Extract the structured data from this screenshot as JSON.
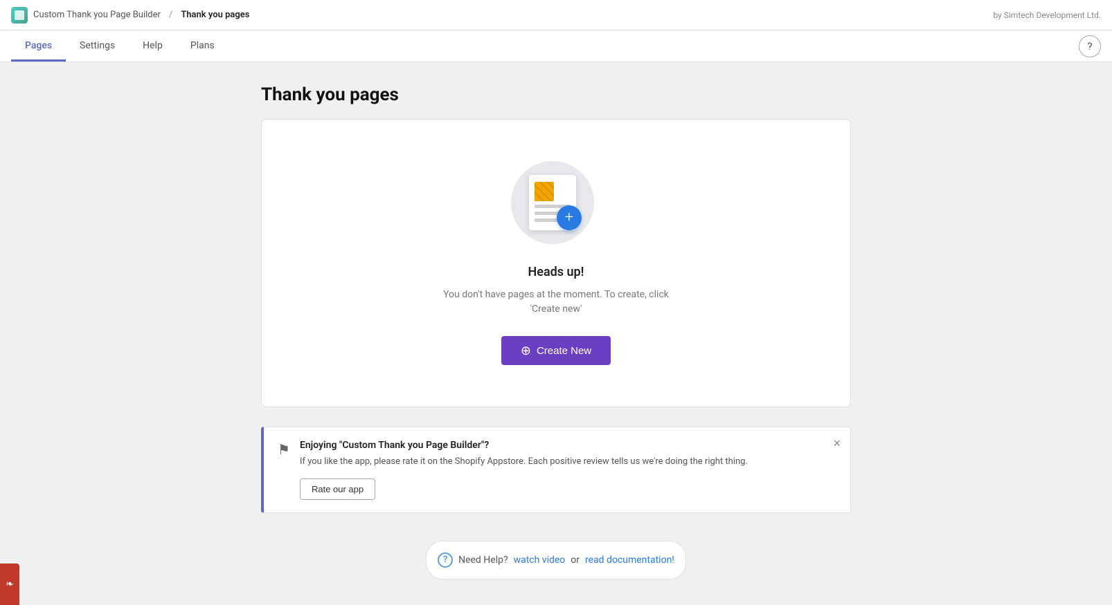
{
  "topbar": {
    "app_name": "Custom Thank you Page Builder",
    "separator": "/",
    "current_page": "Thank you pages",
    "by_text": "by Simtech Development Ltd."
  },
  "nav": {
    "tabs": [
      {
        "id": "pages",
        "label": "Pages",
        "active": true
      },
      {
        "id": "settings",
        "label": "Settings",
        "active": false
      },
      {
        "id": "help",
        "label": "Help",
        "active": false
      },
      {
        "id": "plans",
        "label": "Plans",
        "active": false
      }
    ],
    "help_button_label": "?"
  },
  "main": {
    "page_title": "Thank you pages",
    "empty_state": {
      "heading": "Heads up!",
      "description": "You don't have pages at the moment. To create, click 'Create new'",
      "create_button_label": "Create New"
    },
    "notification": {
      "title": "Enjoying \"Custom Thank you Page Builder\"?",
      "text": "If you like the app, please rate it on the Shopify Appstore. Each positive review tells us we're doing the right thing.",
      "rate_button_label": "Rate our app",
      "close_label": "×"
    },
    "footer_help": {
      "prefix": "Need Help?",
      "watch_video_label": "watch video",
      "or_text": "or",
      "read_docs_label": "read documentation!"
    }
  }
}
